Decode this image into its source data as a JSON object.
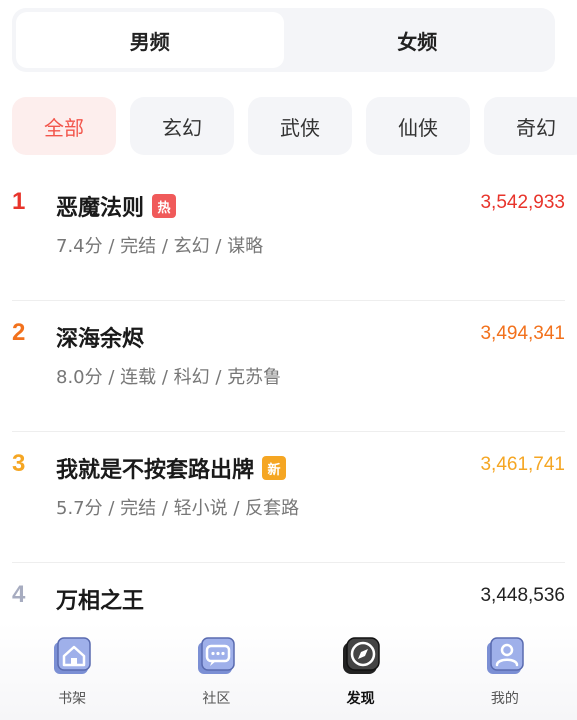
{
  "gender_tabs": [
    {
      "label": "男频",
      "active": true
    },
    {
      "label": "女频",
      "active": false
    }
  ],
  "categories": [
    {
      "label": "全部",
      "active": true
    },
    {
      "label": "玄幻",
      "active": false
    },
    {
      "label": "武侠",
      "active": false
    },
    {
      "label": "仙侠",
      "active": false
    },
    {
      "label": "奇幻",
      "active": false
    }
  ],
  "ranking": [
    {
      "rank": "1",
      "title": "恶魔法则",
      "badge": "热",
      "badge_color": "#f05a5a",
      "meta": "7.4分 / 完结 / 玄幻 / 谋略",
      "count": "3,542,933",
      "rank_color": "#e8342b",
      "count_color": "#e8342b"
    },
    {
      "rank": "2",
      "title": "深海余烬",
      "badge": "",
      "badge_color": "",
      "meta": "8.0分 / 连载 / 科幻 / 克苏鲁",
      "count": "3,494,341",
      "rank_color": "#f2711c",
      "count_color": "#f2711c"
    },
    {
      "rank": "3",
      "title": "我就是不按套路出牌",
      "badge": "新",
      "badge_color": "#f5a623",
      "meta": "5.7分 / 完结 / 轻小说 / 反套路",
      "count": "3,461,741",
      "rank_color": "#f5a623",
      "count_color": "#f5a623"
    },
    {
      "rank": "4",
      "title": "万相之王",
      "badge": "",
      "badge_color": "",
      "meta": "",
      "count": "3,448,536",
      "rank_color": "#a7acc0",
      "count_color": "#222222"
    }
  ],
  "bottom_nav": [
    {
      "label": "书架",
      "icon": "bookshelf-house-icon",
      "active": false
    },
    {
      "label": "社区",
      "icon": "community-chat-icon",
      "active": false
    },
    {
      "label": "发现",
      "icon": "discover-compass-icon",
      "active": true
    },
    {
      "label": "我的",
      "icon": "profile-person-icon",
      "active": false
    }
  ],
  "colors": {
    "accent_red": "#f2564c",
    "nav_icon_blue": "#7b8fd4",
    "nav_icon_active": "#222222"
  }
}
